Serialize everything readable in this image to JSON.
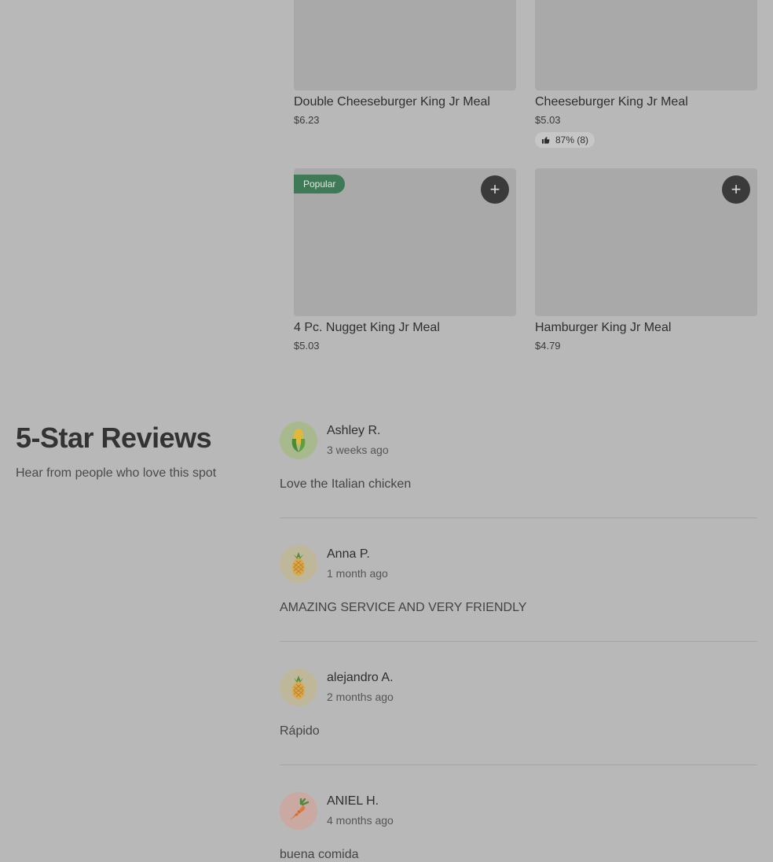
{
  "menu": {
    "items": [
      {
        "title": "Double Cheeseburger King Jr Meal",
        "price": "$6.23"
      },
      {
        "title": "Cheeseburger King Jr Meal",
        "price": "$5.03",
        "rating": "87% (8)"
      },
      {
        "title": "4 Pc. Nugget King Jr Meal",
        "price": "$5.03",
        "badge": "Popular",
        "add_label": "+"
      },
      {
        "title": "Hamburger King Jr Meal",
        "price": "$4.79",
        "add_label": "+"
      }
    ]
  },
  "reviews": {
    "heading": "5-Star Reviews",
    "subheading": "Hear from people who love this spot",
    "items": [
      {
        "name": "Ashley R.",
        "date": "3 weeks ago",
        "text": "Love the Italian chicken",
        "avatar": "corn-icon",
        "avatar_color": "#a9b98e"
      },
      {
        "name": "Anna P.",
        "date": "1 month ago",
        "text": "AMAZING SERVICE AND VERY FRIENDLY",
        "avatar": "pineapple-icon",
        "avatar_color": "#bfb79a"
      },
      {
        "name": "alejandro A.",
        "date": "2 months ago",
        "text": "Rápido",
        "avatar": "pineapple-icon",
        "avatar_color": "#bfb79a"
      },
      {
        "name": "ANIEL H.",
        "date": "4 months ago",
        "text": "buena comida",
        "avatar": "carrot-icon",
        "avatar_color": "#c9a9a1"
      }
    ]
  }
}
